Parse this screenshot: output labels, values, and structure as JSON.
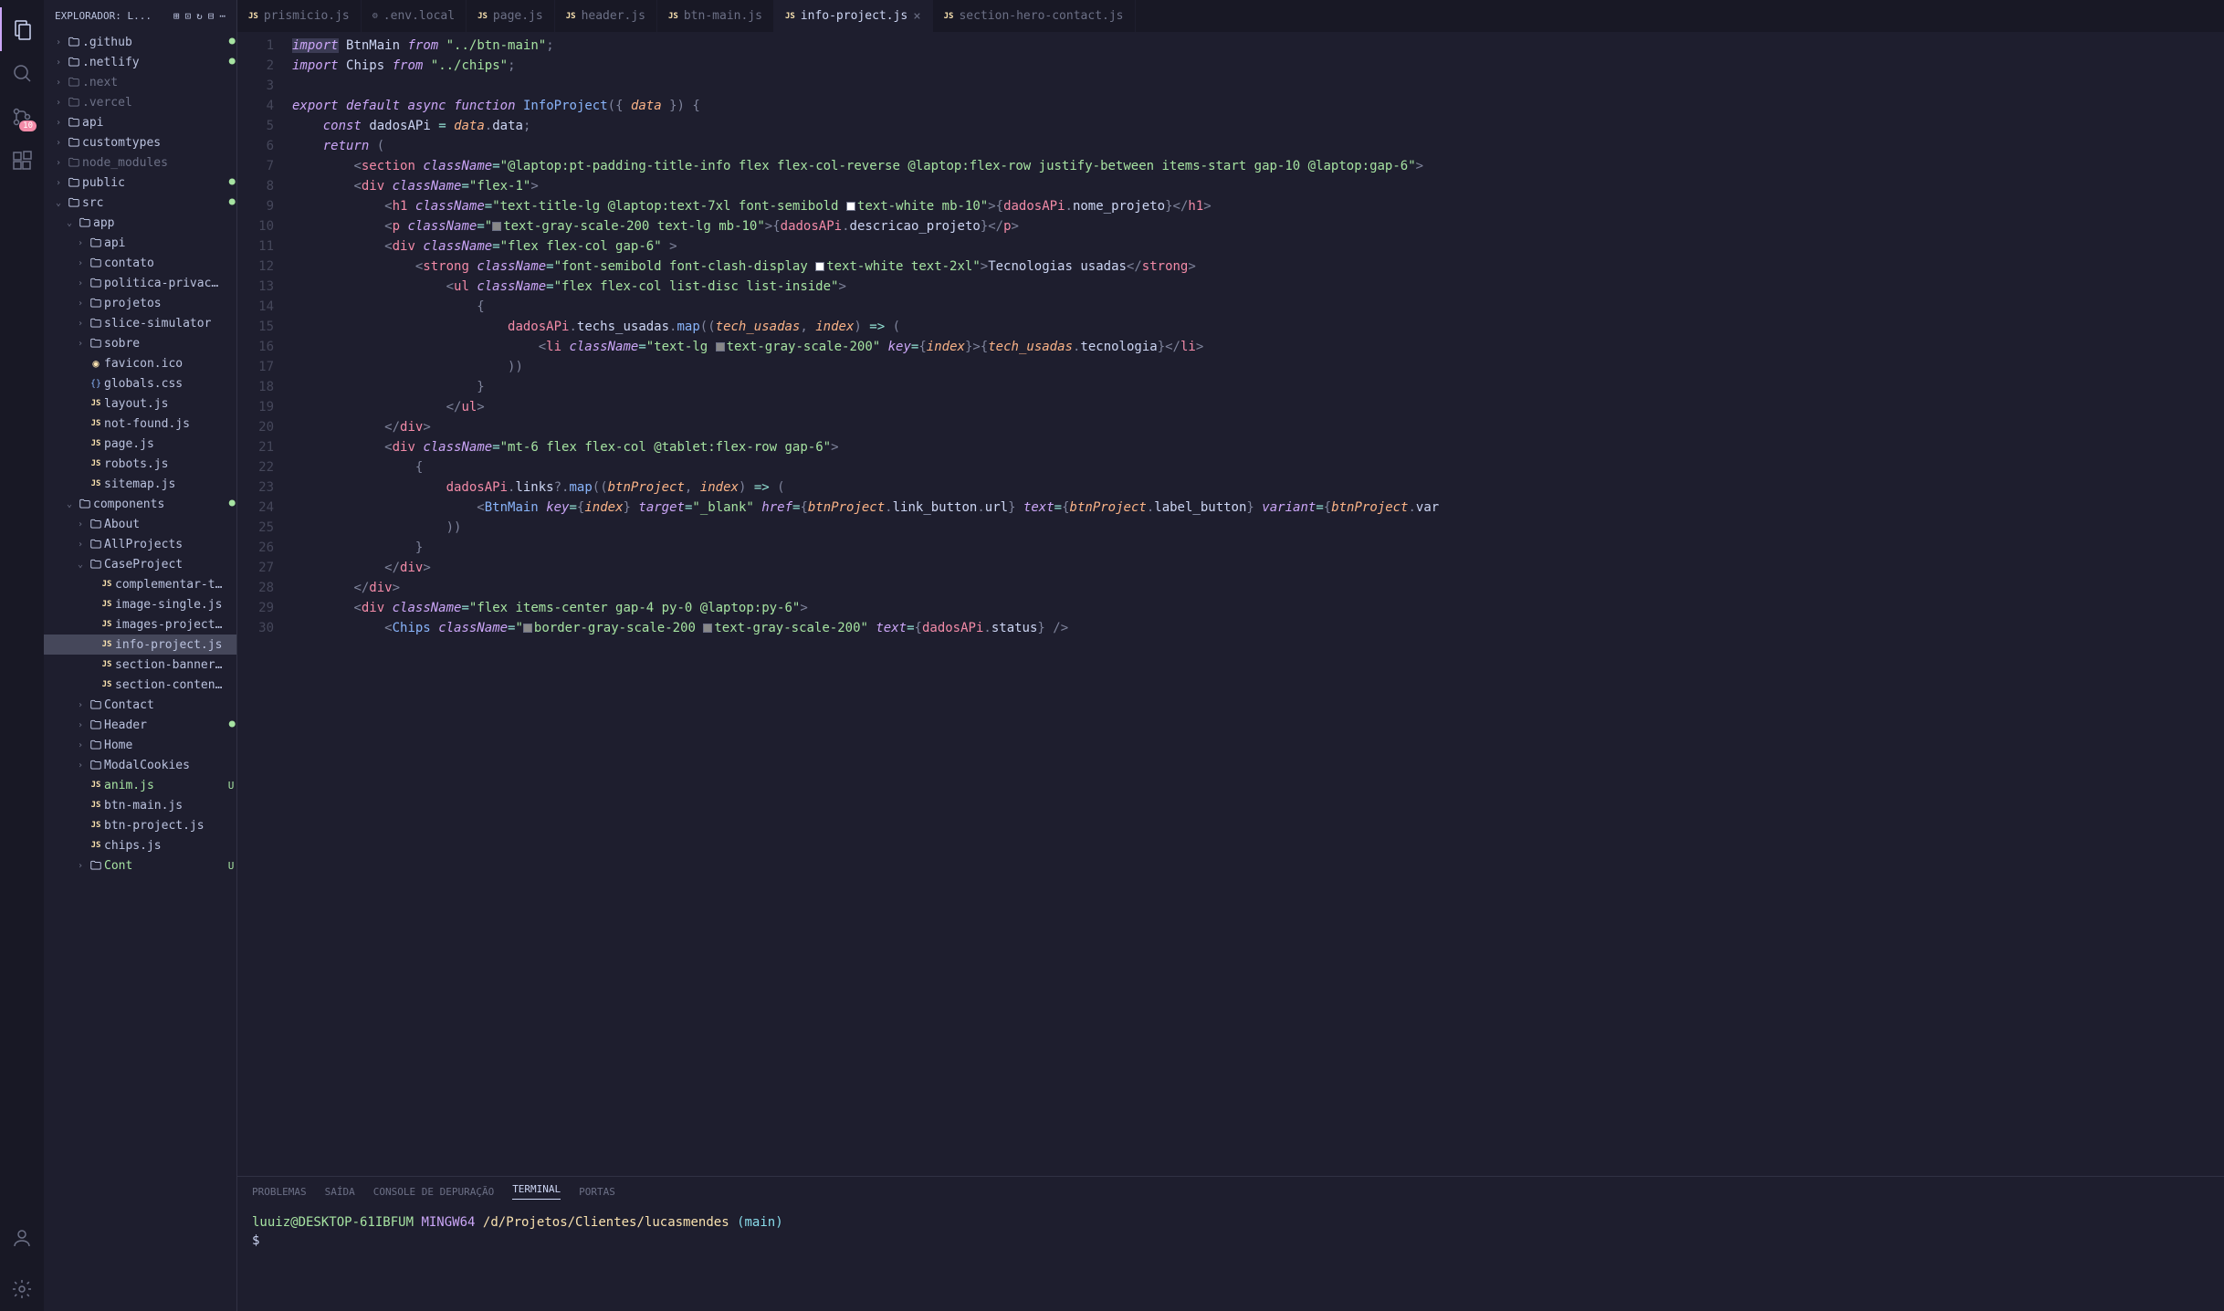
{
  "activityBar": {
    "badge": "10"
  },
  "sidebar": {
    "title": "EXPLORADOR: L...",
    "tree": [
      {
        "indent": 0,
        "chevron": ">",
        "type": "folder",
        "label": ".github",
        "marker": "dot"
      },
      {
        "indent": 0,
        "chevron": ">",
        "type": "folder",
        "label": ".netlify",
        "marker": "dot"
      },
      {
        "indent": 0,
        "chevron": ">",
        "type": "folder-dim",
        "label": ".next",
        "marker": ""
      },
      {
        "indent": 0,
        "chevron": ">",
        "type": "folder-dim",
        "label": ".vercel",
        "marker": ""
      },
      {
        "indent": 0,
        "chevron": ">",
        "type": "folder",
        "label": "api",
        "marker": ""
      },
      {
        "indent": 0,
        "chevron": ">",
        "type": "folder",
        "label": "customtypes",
        "marker": ""
      },
      {
        "indent": 0,
        "chevron": ">",
        "type": "folder-dim",
        "label": "node_modules",
        "marker": ""
      },
      {
        "indent": 0,
        "chevron": ">",
        "type": "folder",
        "label": "public",
        "marker": "dot"
      },
      {
        "indent": 0,
        "chevron": "v",
        "type": "folder",
        "label": "src",
        "marker": "dot"
      },
      {
        "indent": 1,
        "chevron": "v",
        "type": "folder",
        "label": "app",
        "marker": ""
      },
      {
        "indent": 2,
        "chevron": ">",
        "type": "folder",
        "label": "api",
        "marker": ""
      },
      {
        "indent": 2,
        "chevron": ">",
        "type": "folder",
        "label": "contato",
        "marker": ""
      },
      {
        "indent": 2,
        "chevron": ">",
        "type": "folder",
        "label": "politica-privacidade",
        "marker": ""
      },
      {
        "indent": 2,
        "chevron": ">",
        "type": "folder",
        "label": "projetos",
        "marker": ""
      },
      {
        "indent": 2,
        "chevron": ">",
        "type": "folder",
        "label": "slice-simulator",
        "marker": ""
      },
      {
        "indent": 2,
        "chevron": ">",
        "type": "folder",
        "label": "sobre",
        "marker": ""
      },
      {
        "indent": 2,
        "chevron": "",
        "type": "favicon",
        "label": "favicon.ico",
        "marker": ""
      },
      {
        "indent": 2,
        "chevron": "",
        "type": "css",
        "label": "globals.css",
        "marker": ""
      },
      {
        "indent": 2,
        "chevron": "",
        "type": "js",
        "label": "layout.js",
        "marker": ""
      },
      {
        "indent": 2,
        "chevron": "",
        "type": "js",
        "label": "not-found.js",
        "marker": ""
      },
      {
        "indent": 2,
        "chevron": "",
        "type": "js",
        "label": "page.js",
        "marker": ""
      },
      {
        "indent": 2,
        "chevron": "",
        "type": "js",
        "label": "robots.js",
        "marker": ""
      },
      {
        "indent": 2,
        "chevron": "",
        "type": "js",
        "label": "sitemap.js",
        "marker": ""
      },
      {
        "indent": 1,
        "chevron": "v",
        "type": "folder",
        "label": "components",
        "marker": "dot"
      },
      {
        "indent": 2,
        "chevron": ">",
        "type": "folder",
        "label": "About",
        "marker": ""
      },
      {
        "indent": 2,
        "chevron": ">",
        "type": "folder",
        "label": "AllProjects",
        "marker": ""
      },
      {
        "indent": 2,
        "chevron": "v",
        "type": "folder",
        "label": "CaseProject",
        "marker": ""
      },
      {
        "indent": 3,
        "chevron": "",
        "type": "js",
        "label": "complementar-text.js",
        "marker": ""
      },
      {
        "indent": 3,
        "chevron": "",
        "type": "js",
        "label": "image-single.js",
        "marker": ""
      },
      {
        "indent": 3,
        "chevron": "",
        "type": "js",
        "label": "images-project.js",
        "marker": ""
      },
      {
        "indent": 3,
        "chevron": "",
        "type": "js",
        "label": "info-project.js",
        "marker": "",
        "selected": true
      },
      {
        "indent": 3,
        "chevron": "",
        "type": "js",
        "label": "section-banner.js",
        "marker": ""
      },
      {
        "indent": 3,
        "chevron": "",
        "type": "js",
        "label": "section-content.js",
        "marker": ""
      },
      {
        "indent": 2,
        "chevron": ">",
        "type": "folder",
        "label": "Contact",
        "marker": ""
      },
      {
        "indent": 2,
        "chevron": ">",
        "type": "folder",
        "label": "Header",
        "marker": "dot"
      },
      {
        "indent": 2,
        "chevron": ">",
        "type": "folder",
        "label": "Home",
        "marker": ""
      },
      {
        "indent": 2,
        "chevron": ">",
        "type": "folder",
        "label": "ModalCookies",
        "marker": ""
      },
      {
        "indent": 2,
        "chevron": "",
        "type": "js",
        "label": "anim.js",
        "marker": "U"
      },
      {
        "indent": 2,
        "chevron": "",
        "type": "js",
        "label": "btn-main.js",
        "marker": ""
      },
      {
        "indent": 2,
        "chevron": "",
        "type": "js",
        "label": "btn-project.js",
        "marker": ""
      },
      {
        "indent": 2,
        "chevron": "",
        "type": "js",
        "label": "chips.js",
        "marker": ""
      },
      {
        "indent": 2,
        "chevron": ">",
        "type": "folder",
        "label": "Cont",
        "marker": "U"
      }
    ]
  },
  "tabs": [
    {
      "icon": "js",
      "label": "prismicio.js",
      "active": false
    },
    {
      "icon": "gear",
      "label": ".env.local",
      "active": false
    },
    {
      "icon": "js",
      "label": "page.js",
      "active": false
    },
    {
      "icon": "js",
      "label": "header.js",
      "active": false
    },
    {
      "icon": "js",
      "label": "btn-main.js",
      "active": false
    },
    {
      "icon": "js",
      "label": "info-project.js",
      "active": true,
      "close": true
    },
    {
      "icon": "js",
      "label": "section-hero-contact.js",
      "active": false
    }
  ],
  "code": {
    "lines": [
      {
        "n": 1,
        "html": "<span class='kw hilite'>import</span> <span class='const-var'>BtnMain</span> <span class='kw'>from</span> <span class='str'>\"../btn-main\"</span><span class='punc'>;</span>"
      },
      {
        "n": 2,
        "bulb": true,
        "html": "<span class='kw'>import</span> <span class='const-var'>Chips</span> <span class='kw'>from</span> <span class='str'>\"../chips\"</span><span class='punc'>;</span>"
      },
      {
        "n": 3,
        "html": ""
      },
      {
        "n": 4,
        "html": "<span class='kw'>export</span> <span class='kw'>default</span> <span class='kw'>async</span> <span class='kw'>function</span> <span class='fn'>InfoProject</span><span class='punc'>({</span> <span class='param'>data</span> <span class='punc'>}) {</span>"
      },
      {
        "n": 5,
        "html": "    <span class='kw'>const</span> <span class='const-var'>dadosAPi</span> <span class='op'>=</span> <span class='param'>data</span><span class='punc'>.</span><span class='prop'>data</span><span class='punc'>;</span>"
      },
      {
        "n": 6,
        "html": "    <span class='kw'>return</span> <span class='punc'>(</span>"
      },
      {
        "n": 7,
        "html": "        <span class='punc'>&lt;</span><span class='tag'>section</span> <span class='attr'>className</span><span class='op'>=</span><span class='str'>\"@laptop:pt-padding-title-info flex flex-col-reverse @laptop:flex-row justify-between items-start gap-10 @laptop:gap-6\"</span><span class='punc'>&gt;</span>"
      },
      {
        "n": 8,
        "html": "        <span class='punc'>&lt;</span><span class='tag'>div</span> <span class='attr'>className</span><span class='op'>=</span><span class='str'>\"flex-1\"</span><span class='punc'>&gt;</span>"
      },
      {
        "n": 9,
        "html": "            <span class='punc'>&lt;</span><span class='tag'>h1</span> <span class='attr'>className</span><span class='op'>=</span><span class='str'>\"text-title-lg @laptop:text-7xl font-semibold <span class='colorbox' style='background:#fff'></span>text-white mb-10\"</span><span class='punc'>&gt;{</span><span class='var'>dadosAPi</span><span class='punc'>.</span><span class='prop'>nome_projeto</span><span class='punc'>}&lt;/</span><span class='tag'>h1</span><span class='punc'>&gt;</span>"
      },
      {
        "n": 10,
        "html": "            <span class='punc'>&lt;</span><span class='tag'>p</span> <span class='attr'>className</span><span class='op'>=</span><span class='str'>\"<span class='colorbox' style='background:#888'></span>text-gray-scale-200 text-lg mb-10\"</span><span class='punc'>&gt;{</span><span class='var'>dadosAPi</span><span class='punc'>.</span><span class='prop'>descricao_projeto</span><span class='punc'>}&lt;/</span><span class='tag'>p</span><span class='punc'>&gt;</span>"
      },
      {
        "n": 11,
        "html": "            <span class='punc'>&lt;</span><span class='tag'>div</span> <span class='attr'>className</span><span class='op'>=</span><span class='str'>\"flex flex-col gap-6\"</span> <span class='punc'>&gt;</span>"
      },
      {
        "n": 12,
        "html": "                <span class='punc'>&lt;</span><span class='tag'>strong</span> <span class='attr'>className</span><span class='op'>=</span><span class='str'>\"font-semibold font-clash-display <span class='colorbox' style='background:#fff'></span>text-white text-2xl\"</span><span class='punc'>&gt;</span>Tecnologias usadas<span class='punc'>&lt;/</span><span class='tag'>strong</span><span class='punc'>&gt;</span>"
      },
      {
        "n": 13,
        "html": "                    <span class='punc'>&lt;</span><span class='tag'>ul</span> <span class='attr'>className</span><span class='op'>=</span><span class='str'>\"flex flex-col list-disc list-inside\"</span><span class='punc'>&gt;</span>"
      },
      {
        "n": 14,
        "html": "                        <span class='punc'>{</span>"
      },
      {
        "n": 15,
        "html": "                            <span class='var'>dadosAPi</span><span class='punc'>.</span><span class='prop'>techs_usadas</span><span class='punc'>.</span><span class='fn'>map</span><span class='punc'>((</span><span class='param'>tech_usadas</span><span class='punc'>,</span> <span class='param'>index</span><span class='punc'>)</span> <span class='op'>=&gt;</span> <span class='punc'>(</span>"
      },
      {
        "n": 16,
        "html": "                                <span class='punc'>&lt;</span><span class='tag'>li</span> <span class='attr'>className</span><span class='op'>=</span><span class='str'>\"text-lg <span class='colorbox' style='background:#888'></span>text-gray-scale-200\"</span> <span class='attr'>key</span><span class='op'>=</span><span class='punc'>{</span><span class='param'>index</span><span class='punc'>}&gt;{</span><span class='param'>tech_usadas</span><span class='punc'>.</span><span class='prop'>tecnologia</span><span class='punc'>}&lt;/</span><span class='tag'>li</span><span class='punc'>&gt;</span>"
      },
      {
        "n": 17,
        "html": "                            <span class='punc'>))</span>"
      },
      {
        "n": 18,
        "html": "                        <span class='punc'>}</span>"
      },
      {
        "n": 19,
        "html": "                    <span class='punc'>&lt;/</span><span class='tag'>ul</span><span class='punc'>&gt;</span>"
      },
      {
        "n": 20,
        "html": "            <span class='punc'>&lt;/</span><span class='tag'>div</span><span class='punc'>&gt;</span>"
      },
      {
        "n": 21,
        "html": "            <span class='punc'>&lt;</span><span class='tag'>div</span> <span class='attr'>className</span><span class='op'>=</span><span class='str'>\"mt-6 flex flex-col @tablet:flex-row gap-6\"</span><span class='punc'>&gt;</span>"
      },
      {
        "n": 22,
        "html": "                <span class='punc'>{</span>"
      },
      {
        "n": 23,
        "html": "                    <span class='var'>dadosAPi</span><span class='punc'>.</span><span class='prop'>links</span><span class='punc'>?.</span><span class='fn'>map</span><span class='punc'>((</span><span class='param'>btnProject</span><span class='punc'>,</span> <span class='param'>index</span><span class='punc'>)</span> <span class='op'>=&gt;</span> <span class='punc'>(</span>"
      },
      {
        "n": 24,
        "html": "                        <span class='punc'>&lt;</span><span class='fn'>BtnMain</span> <span class='attr'>key</span><span class='op'>=</span><span class='punc'>{</span><span class='param'>index</span><span class='punc'>}</span> <span class='attr'>target</span><span class='op'>=</span><span class='str'>\"_blank\"</span> <span class='attr'>href</span><span class='op'>=</span><span class='punc'>{</span><span class='param'>btnProject</span><span class='punc'>.</span><span class='prop'>link_button</span><span class='punc'>.</span><span class='prop'>url</span><span class='punc'>}</span> <span class='attr'>text</span><span class='op'>=</span><span class='punc'>{</span><span class='param'>btnProject</span><span class='punc'>.</span><span class='prop'>label_button</span><span class='punc'>}</span> <span class='attr'>variant</span><span class='op'>=</span><span class='punc'>{</span><span class='param'>btnProject</span><span class='punc'>.</span><span class='prop'>var</span>"
      },
      {
        "n": 25,
        "html": "                    <span class='punc'>))</span>"
      },
      {
        "n": 26,
        "html": "                <span class='punc'>}</span>"
      },
      {
        "n": 27,
        "html": "            <span class='punc'>&lt;/</span><span class='tag'>div</span><span class='punc'>&gt;</span>"
      },
      {
        "n": 28,
        "html": "        <span class='punc'>&lt;/</span><span class='tag'>div</span><span class='punc'>&gt;</span>"
      },
      {
        "n": 29,
        "html": "        <span class='punc'>&lt;</span><span class='tag'>div</span> <span class='attr'>className</span><span class='op'>=</span><span class='str'>\"flex items-center gap-4 py-0 @laptop:py-6\"</span><span class='punc'>&gt;</span>"
      },
      {
        "n": 30,
        "html": "            <span class='punc'>&lt;</span><span class='fn'>Chips</span> <span class='attr'>className</span><span class='op'>=</span><span class='str'>\"<span class='colorbox' style='background:#888'></span>border-gray-scale-200 <span class='colorbox' style='background:#888'></span>text-gray-scale-200\"</span> <span class='attr'>text</span><span class='op'>=</span><span class='punc'>{</span><span class='var'>dadosAPi</span><span class='punc'>.</span><span class='prop'>status</span><span class='punc'>}</span> <span class='punc'>/&gt;</span>"
      }
    ]
  },
  "panel": {
    "tabs": [
      "PROBLEMAS",
      "SAÍDA",
      "CONSOLE DE DEPURAÇÃO",
      "TERMINAL",
      "PORTAS"
    ],
    "activeTab": "TERMINAL",
    "terminal": {
      "user": "luuiz@DESKTOP-61IBFUM",
      "host": "MINGW64",
      "path": "/d/Projetos/Clientes/lucasmendes",
      "branch": "(main)",
      "prompt": "$"
    }
  }
}
